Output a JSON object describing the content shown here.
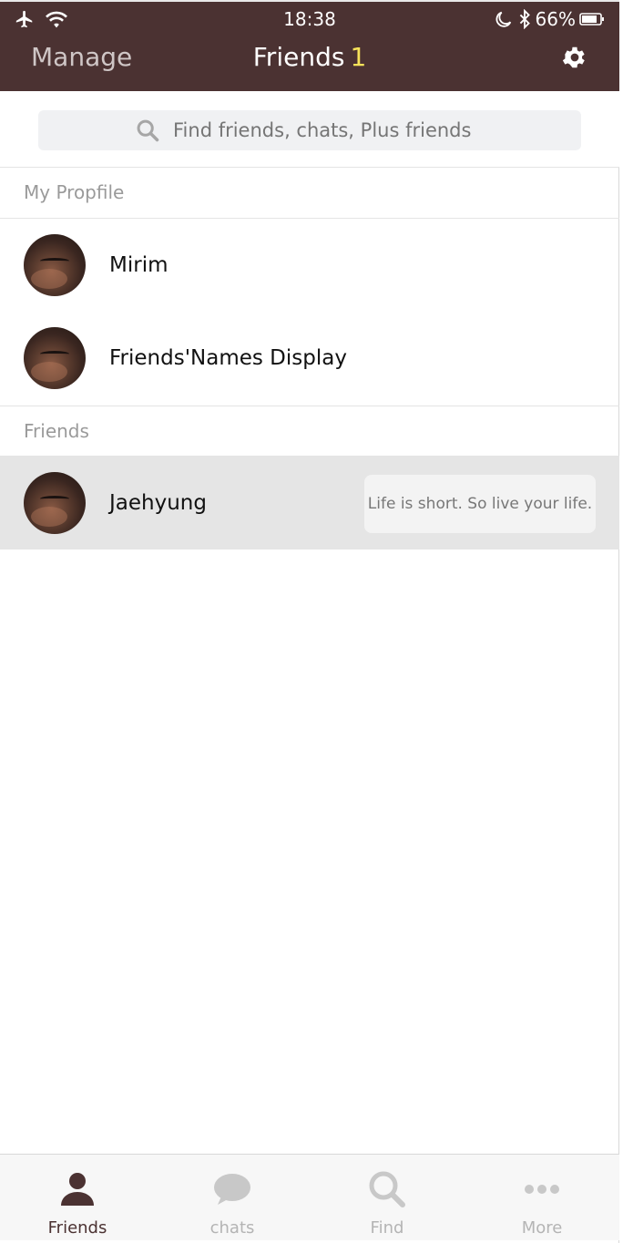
{
  "status_bar": {
    "time": "18:38",
    "battery": "66%",
    "icons": [
      "airplane-icon",
      "wifi-icon",
      "moon-icon",
      "bluetooth-icon",
      "battery-icon"
    ]
  },
  "header": {
    "manage_label": "Manage",
    "title": "Friends",
    "count": "1",
    "settings_icon": "gear-icon"
  },
  "search": {
    "placeholder": "Find friends, chats, Plus friends"
  },
  "my_profile": {
    "section_label": "My Propfile",
    "items": [
      {
        "name": "Mirim"
      },
      {
        "name": "Friends'Names Display"
      }
    ]
  },
  "friends": {
    "section_label": "Friends",
    "items": [
      {
        "name": "Jaehyung",
        "status": "Life is short. So live your life."
      }
    ]
  },
  "tabs": [
    {
      "label": "Friends",
      "icon": "person-icon",
      "active": true
    },
    {
      "label": "chats",
      "icon": "chat-bubble-icon",
      "active": false
    },
    {
      "label": "Find",
      "icon": "search-icon",
      "active": false
    },
    {
      "label": "More",
      "icon": "more-dots-icon",
      "active": false
    }
  ],
  "colors": {
    "header_bg": "#4b3232",
    "count_accent": "#f7e35a",
    "selected_row": "#e5e5e5"
  }
}
